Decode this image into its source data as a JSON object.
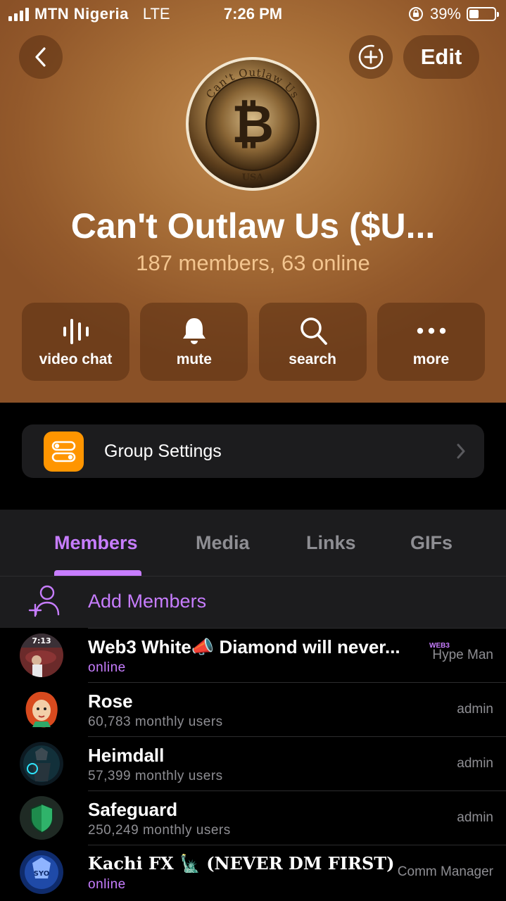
{
  "status_bar": {
    "carrier": "MTN Nigeria",
    "network": "LTE",
    "time": "7:26 PM",
    "battery": "39%",
    "battery_level": 0.39
  },
  "header": {
    "edit_label": "Edit",
    "group_name": "Can't Outlaw Us ($U...",
    "members_summary": "187 members, 63 online",
    "avatar_text": "Can't Outlaw Us",
    "avatar_bottom_text": "USA"
  },
  "actions": [
    {
      "label": "video chat",
      "icon": "voice-chat-icon"
    },
    {
      "label": "mute",
      "icon": "bell-icon"
    },
    {
      "label": "search",
      "icon": "search-icon"
    },
    {
      "label": "more",
      "icon": "more-icon"
    }
  ],
  "settings": {
    "label": "Group Settings",
    "icon": "sliders-icon",
    "icon_color": "#ff9500"
  },
  "tabs": [
    {
      "label": "Members",
      "active": true
    },
    {
      "label": "Media",
      "active": false
    },
    {
      "label": "Links",
      "active": false
    },
    {
      "label": "GIFs",
      "active": false
    }
  ],
  "add_members": {
    "label": "Add Members"
  },
  "accent_color": "#c77dff",
  "members": [
    {
      "name": "Web3 White📣 Diamond will never...",
      "status": "online",
      "role": "Hype Man",
      "tag": "WEB3",
      "avatar_text": "7:13"
    },
    {
      "name": "Rose",
      "status": "60,783 monthly users",
      "role": "admin"
    },
    {
      "name": "Heimdall",
      "status": "57,399 monthly users",
      "role": "admin"
    },
    {
      "name": "Safeguard",
      "status": "250,249 monthly users",
      "role": "admin"
    },
    {
      "name": "Kachi FX 🗽 (NEVER DM FIRST)",
      "status": "online",
      "role": "Comm Manager",
      "avatar_text": "SYO"
    }
  ]
}
